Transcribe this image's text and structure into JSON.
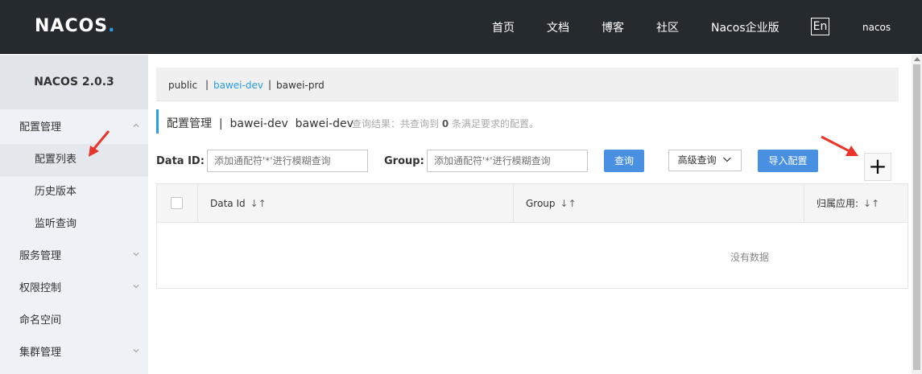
{
  "header": {
    "logo": "NACOS",
    "logo_dot": ".",
    "nav": [
      "首页",
      "文档",
      "博客",
      "社区",
      "Nacos企业版"
    ],
    "lang": "En",
    "user": "nacos"
  },
  "sidebar": {
    "title": "NACOS 2.0.3",
    "menu": [
      {
        "label": "配置管理",
        "chevron": "up"
      },
      {
        "label": "服务管理",
        "chevron": "down"
      },
      {
        "label": "权限控制",
        "chevron": "down"
      },
      {
        "label": "命名空间"
      },
      {
        "label": "集群管理",
        "chevron": "down"
      }
    ],
    "sub_items": [
      "配置列表",
      "历史版本",
      "监听查询"
    ]
  },
  "namespaces": {
    "items": [
      "public",
      "bawei-dev",
      "bawei-prd"
    ],
    "separator": "|",
    "active": "bawei-dev"
  },
  "page": {
    "title": "配置管理  |  bawei-dev  bawei-dev",
    "result_prefix": "查询结果：共查询到",
    "result_count": "0",
    "result_suffix": "条满足要求的配置。"
  },
  "search": {
    "dataid_label": "Data ID:",
    "dataid_placeholder": "添加通配符'*'进行模糊查询",
    "group_label": "Group:",
    "group_placeholder": "添加通配符'*'进行模糊查询",
    "query_button": "查询",
    "advanced_button": "高级查询",
    "import_button": "导入配置",
    "add_button": "+"
  },
  "table": {
    "columns": [
      "Data Id",
      "Group",
      "归属应用:"
    ],
    "sort_icon": "↓↑",
    "empty_text": "没有数据"
  },
  "colors": {
    "header_bg": "#252a2f",
    "accent": "#2a9ce3",
    "primary_button": "#4a90e2",
    "annotation_arrow": "#e8352a"
  },
  "icons": [
    "chevron-up-icon",
    "chevron-down-icon",
    "sort-icon",
    "plus-icon",
    "red-arrow-icon"
  ]
}
